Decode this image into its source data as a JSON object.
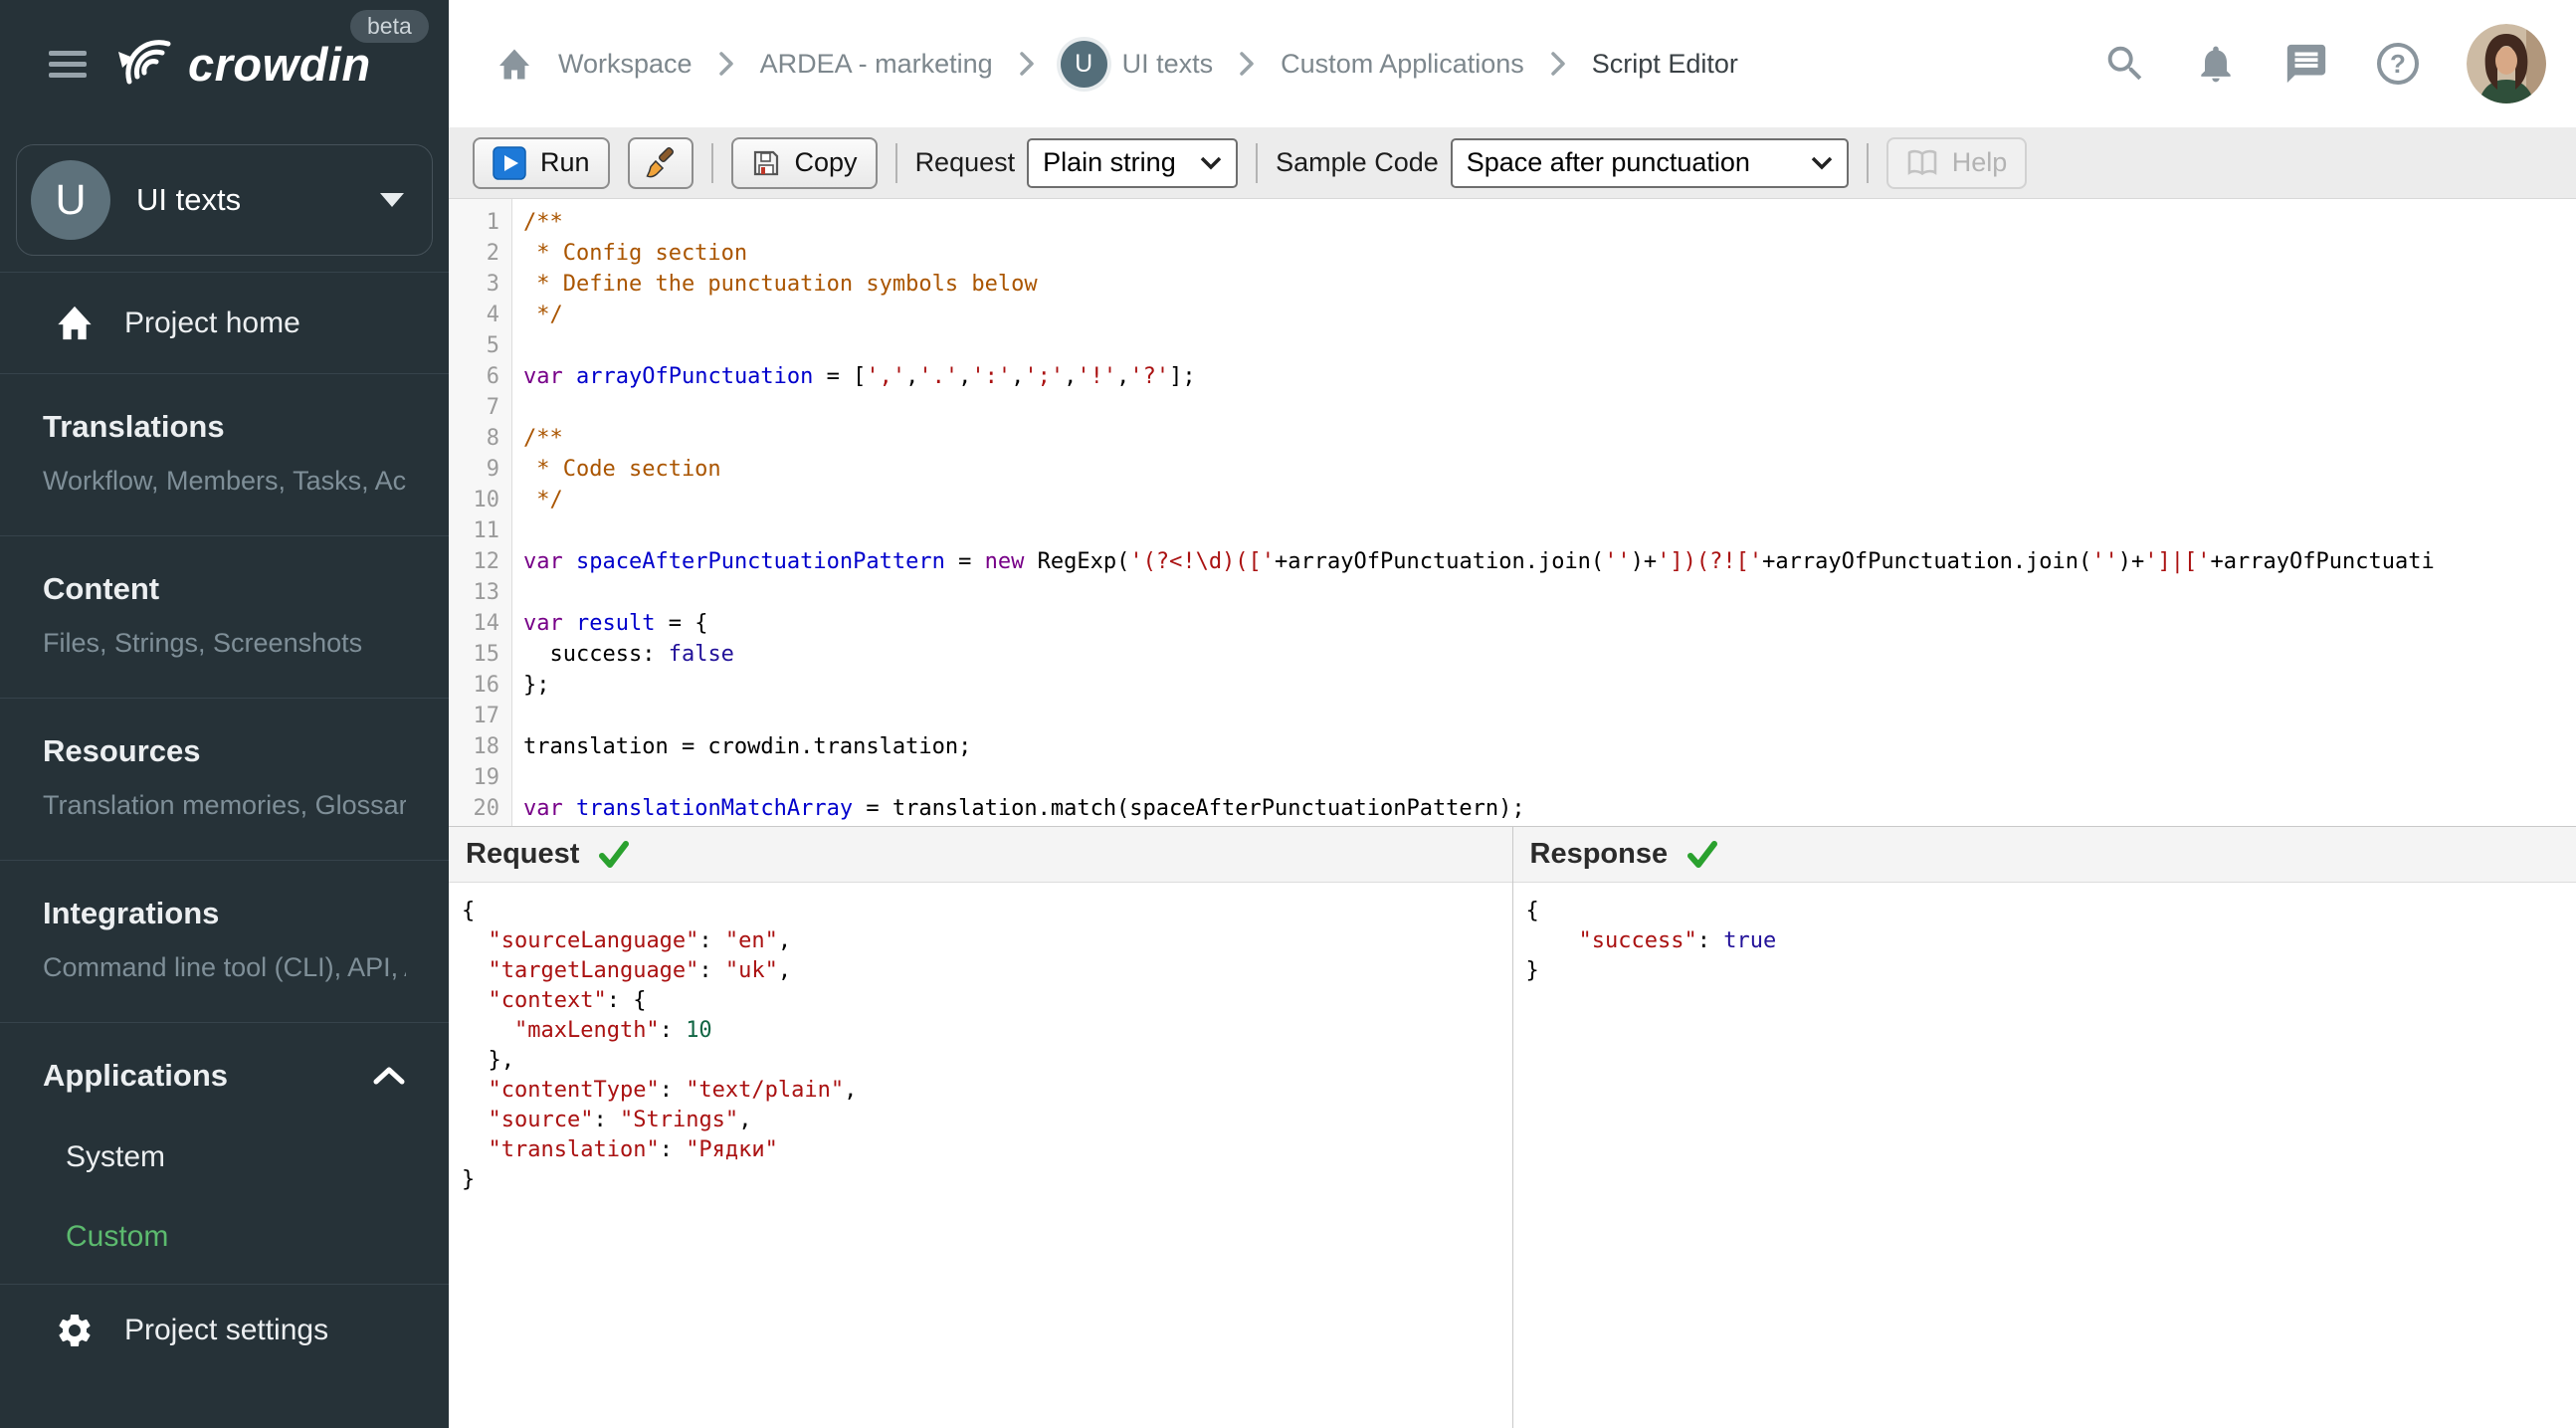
{
  "topbar": {
    "logo_text": "crowdin",
    "beta_label": "beta",
    "breadcrumbs": [
      {
        "label": "Workspace"
      },
      {
        "label": "ARDEA - marketing"
      },
      {
        "label": "UI texts",
        "avatar": "U"
      },
      {
        "label": "Custom Applications"
      },
      {
        "label": "Script Editor",
        "current": true
      }
    ],
    "icons": {
      "search-icon": "magnifier",
      "notifications-icon": "bell",
      "messages-icon": "chat-bubble",
      "help-icon": "question-circle",
      "user-avatar": "profile-photo"
    }
  },
  "sidebar": {
    "project": {
      "initial": "U",
      "name": "UI texts"
    },
    "home_label": "Project home",
    "sections": [
      {
        "title": "Translations",
        "subtitle": "Workflow, Members, Tasks, Act…"
      },
      {
        "title": "Content",
        "subtitle": "Files, Strings, Screenshots"
      },
      {
        "title": "Resources",
        "subtitle": "Translation memories, Glossari…"
      },
      {
        "title": "Integrations",
        "subtitle": "Command line tool (CLI), API, A…"
      }
    ],
    "applications": {
      "title": "Applications",
      "items": [
        {
          "label": "System",
          "active": false
        },
        {
          "label": "Custom",
          "active": true
        }
      ]
    },
    "settings_label": "Project settings"
  },
  "toolbar": {
    "run_label": "Run",
    "copy_label": "Copy",
    "request_label": "Request",
    "request_value": "Plain string",
    "sample_code_label": "Sample Code",
    "sample_code_value": "Space after punctuation",
    "help_label": "Help"
  },
  "editor": {
    "lines": [
      [
        [
          "c",
          "/**"
        ]
      ],
      [
        [
          "c",
          " * Config section"
        ]
      ],
      [
        [
          "c",
          " * Define the punctuation symbols below"
        ]
      ],
      [
        [
          "c",
          " */"
        ]
      ],
      [],
      [
        [
          "k",
          "var"
        ],
        [
          "p",
          " "
        ],
        [
          "d",
          "arrayOfPunctuation"
        ],
        [
          "p",
          " = ["
        ],
        [
          "s",
          "','"
        ],
        [
          "p",
          ","
        ],
        [
          "s",
          "'.'"
        ],
        [
          "p",
          ","
        ],
        [
          "s",
          "':'"
        ],
        [
          "p",
          ","
        ],
        [
          "s",
          "';'"
        ],
        [
          "p",
          ","
        ],
        [
          "s",
          "'!'"
        ],
        [
          "p",
          ","
        ],
        [
          "s",
          "'?'"
        ],
        [
          "p",
          "];"
        ]
      ],
      [],
      [
        [
          "c",
          "/**"
        ]
      ],
      [
        [
          "c",
          " * Code section"
        ]
      ],
      [
        [
          "c",
          " */"
        ]
      ],
      [],
      [
        [
          "k",
          "var"
        ],
        [
          "p",
          " "
        ],
        [
          "d",
          "spaceAfterPunctuationPattern"
        ],
        [
          "p",
          " = "
        ],
        [
          "k",
          "new"
        ],
        [
          "p",
          " RegExp("
        ],
        [
          "s",
          "'(?<!\\d)(['"
        ],
        [
          "p",
          "+arrayOfPunctuation.join("
        ],
        [
          "s",
          "''"
        ],
        [
          "p",
          ")+"
        ],
        [
          "s",
          "'])(?!['"
        ],
        [
          "p",
          "+arrayOfPunctuation.join("
        ],
        [
          "s",
          "''"
        ],
        [
          "p",
          ")+"
        ],
        [
          "s",
          "']|['"
        ],
        [
          "p",
          "+arrayOfPunctuati"
        ]
      ],
      [],
      [
        [
          "k",
          "var"
        ],
        [
          "p",
          " "
        ],
        [
          "d",
          "result"
        ],
        [
          "p",
          " = {"
        ]
      ],
      [
        [
          "p",
          "  success: "
        ],
        [
          "a",
          "false"
        ]
      ],
      [
        [
          "p",
          "};"
        ]
      ],
      [],
      [
        [
          "p",
          "translation = crowdin.translation;"
        ]
      ],
      [],
      [
        [
          "k",
          "var"
        ],
        [
          "p",
          " "
        ],
        [
          "d",
          "translationMatchArray"
        ],
        [
          "p",
          " = translation.match(spaceAfterPunctuationPattern);"
        ]
      ],
      []
    ]
  },
  "request_panel": {
    "title": "Request",
    "status": "valid",
    "lines": [
      [
        [
          "p",
          "{"
        ]
      ],
      [
        [
          "p",
          "  "
        ],
        [
          "s",
          "\"sourceLanguage\""
        ],
        [
          "p",
          ": "
        ],
        [
          "s",
          "\"en\""
        ],
        [
          "p",
          ","
        ]
      ],
      [
        [
          "p",
          "  "
        ],
        [
          "s",
          "\"targetLanguage\""
        ],
        [
          "p",
          ": "
        ],
        [
          "s",
          "\"uk\""
        ],
        [
          "p",
          ","
        ]
      ],
      [
        [
          "p",
          "  "
        ],
        [
          "s",
          "\"context\""
        ],
        [
          "p",
          ": {"
        ]
      ],
      [
        [
          "p",
          "    "
        ],
        [
          "s",
          "\"maxLength\""
        ],
        [
          "p",
          ": "
        ],
        [
          "n",
          "10"
        ]
      ],
      [
        [
          "p",
          "  },"
        ]
      ],
      [
        [
          "p",
          "  "
        ],
        [
          "s",
          "\"contentType\""
        ],
        [
          "p",
          ": "
        ],
        [
          "s",
          "\"text/plain\""
        ],
        [
          "p",
          ","
        ]
      ],
      [
        [
          "p",
          "  "
        ],
        [
          "s",
          "\"source\""
        ],
        [
          "p",
          ": "
        ],
        [
          "s",
          "\"Strings\""
        ],
        [
          "p",
          ","
        ]
      ],
      [
        [
          "p",
          "  "
        ],
        [
          "s",
          "\"translation\""
        ],
        [
          "p",
          ": "
        ],
        [
          "s",
          "\"Рядки\""
        ]
      ],
      [
        [
          "p",
          "}"
        ]
      ]
    ]
  },
  "response_panel": {
    "title": "Response",
    "status": "valid",
    "lines": [
      [
        [
          "p",
          "{"
        ]
      ],
      [
        [
          "p",
          "    "
        ],
        [
          "s",
          "\"success\""
        ],
        [
          "p",
          ": "
        ],
        [
          "a",
          "true"
        ]
      ],
      [
        [
          "p",
          "}"
        ]
      ]
    ]
  },
  "colors": {
    "sidebar_bg": "#263238",
    "accent_green": "#5cba6e",
    "run_icon_blue": "#1d79d8",
    "token_comment": "#aa5500",
    "token_keyword": "#770088",
    "token_def": "#0000cc",
    "token_string": "#aa1111",
    "token_atom": "#221199",
    "token_number": "#116644",
    "check_green": "#2aa12e"
  }
}
